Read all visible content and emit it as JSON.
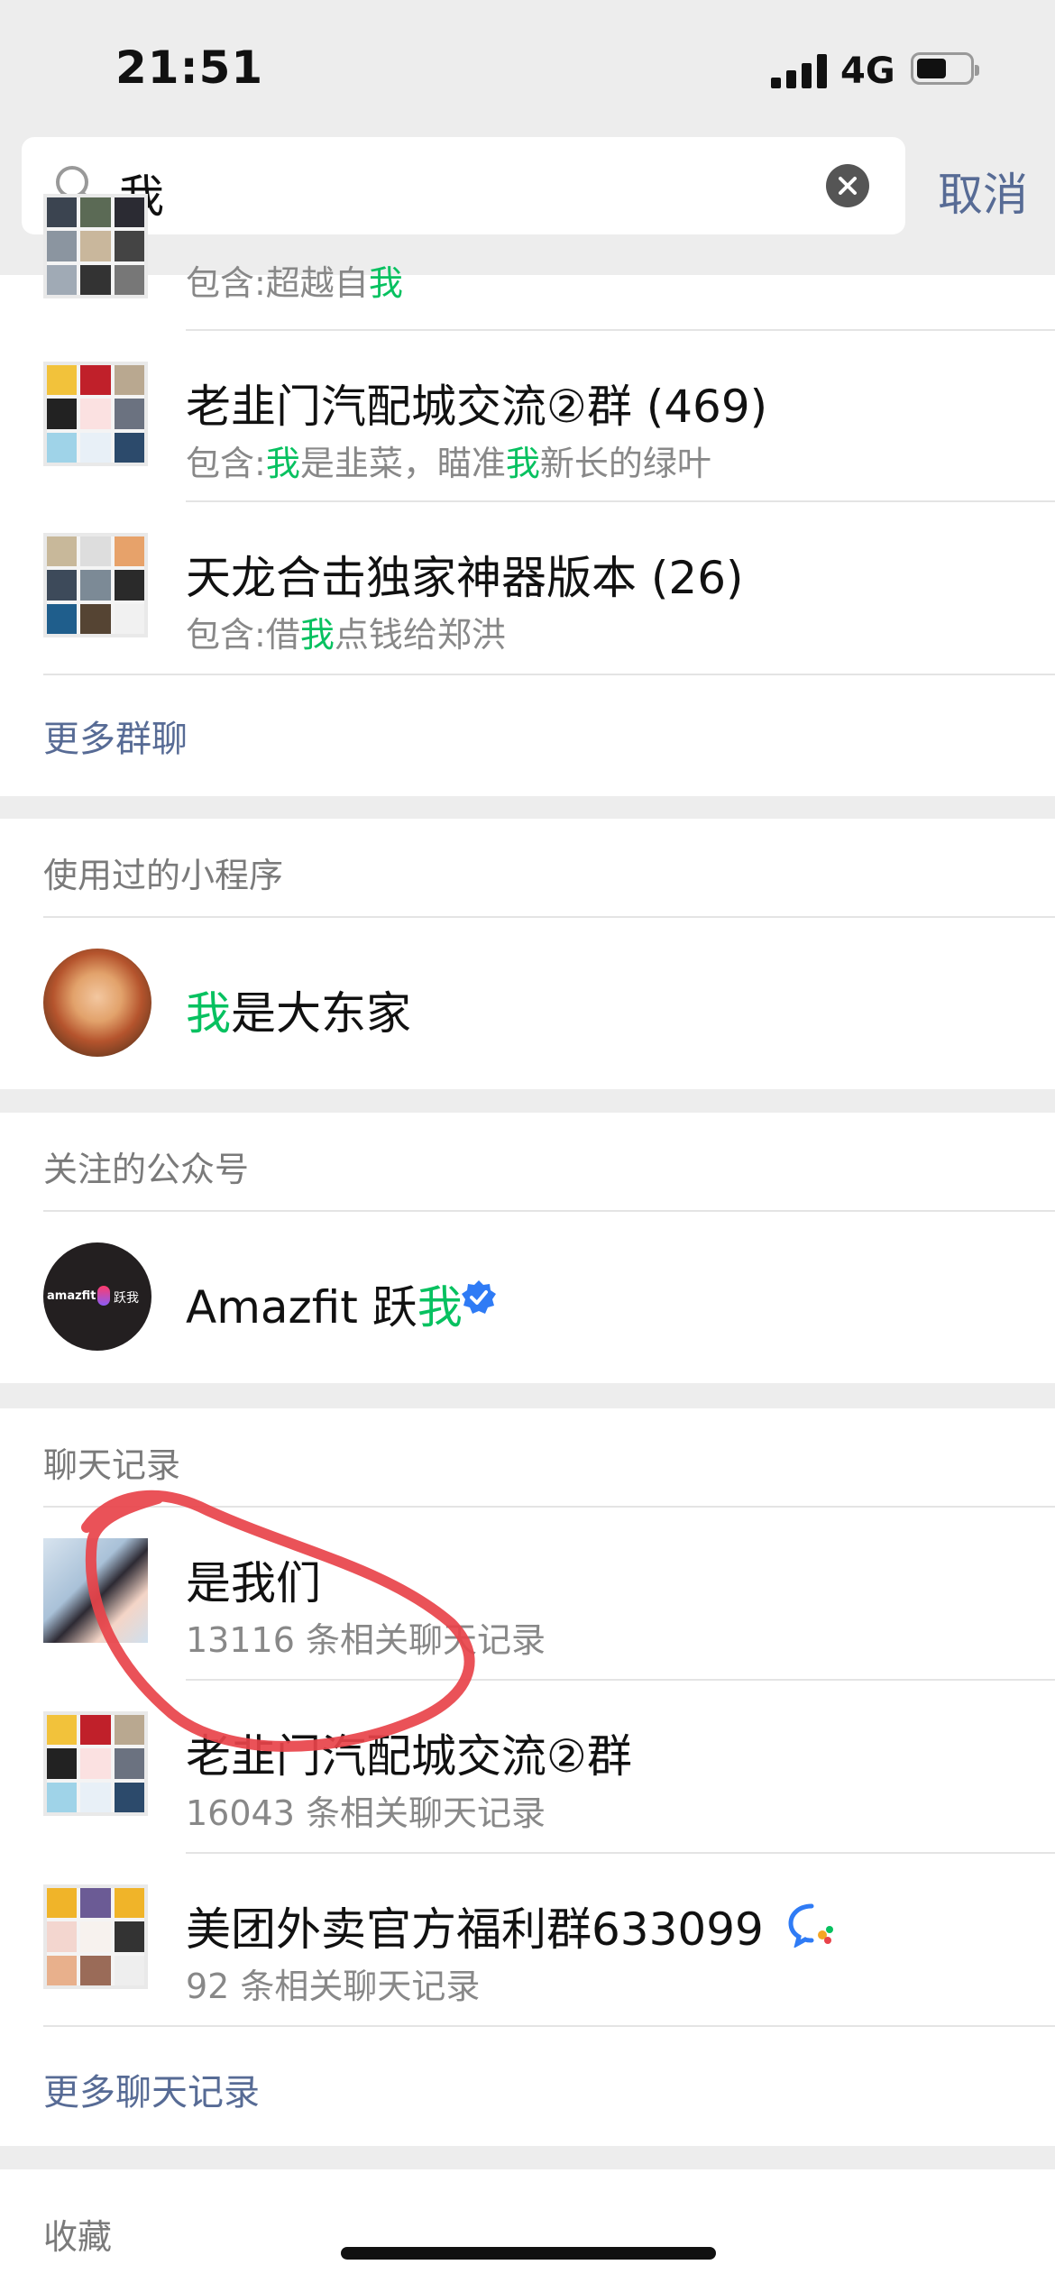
{
  "status_bar": {
    "time": "21:51",
    "network": "4G"
  },
  "search": {
    "query": "我",
    "cancel_label": "取消"
  },
  "group_chats": {
    "partial_item": {
      "subtitle_prefix": "包含:超越自",
      "subtitle_highlight": "我"
    },
    "items": [
      {
        "name": "老韭门汽配城交流②群 (469)",
        "prefix": "包含:",
        "hl1": "我",
        "mid": "是韭菜，瞄准",
        "hl2": "我",
        "suffix": "新长的绿叶"
      },
      {
        "name": "天龙合击独家神器版本 (26)",
        "prefix": "包含:借",
        "hl1": "我",
        "suffix": "点钱给郑洪"
      }
    ],
    "more_label": "更多群聊"
  },
  "mini_programs": {
    "header": "使用过的小程序",
    "item": {
      "highlight": "我",
      "rest": "是大东家"
    }
  },
  "official_accounts": {
    "header": "关注的公众号",
    "item": {
      "name_prefix": "Amazfit 跃",
      "name_highlight": "我",
      "logo_text": "amazfit",
      "logo_badge": "跃我"
    }
  },
  "chat_history": {
    "header": "聊天记录",
    "items": [
      {
        "name": "是我们",
        "detail": "13116 条相关聊天记录"
      },
      {
        "name": "老韭门汽配城交流②群",
        "detail": "16043 条相关聊天记录"
      },
      {
        "name": "美团外卖官方福利群633099",
        "detail": "92 条相关聊天记录"
      }
    ],
    "more_label": "更多聊天记录"
  },
  "favorites": {
    "header": "收藏"
  },
  "colors": {
    "highlight": "#07c160",
    "link": "#576b95",
    "annotation": "#e8434a",
    "verified": "#2f7bf5"
  }
}
